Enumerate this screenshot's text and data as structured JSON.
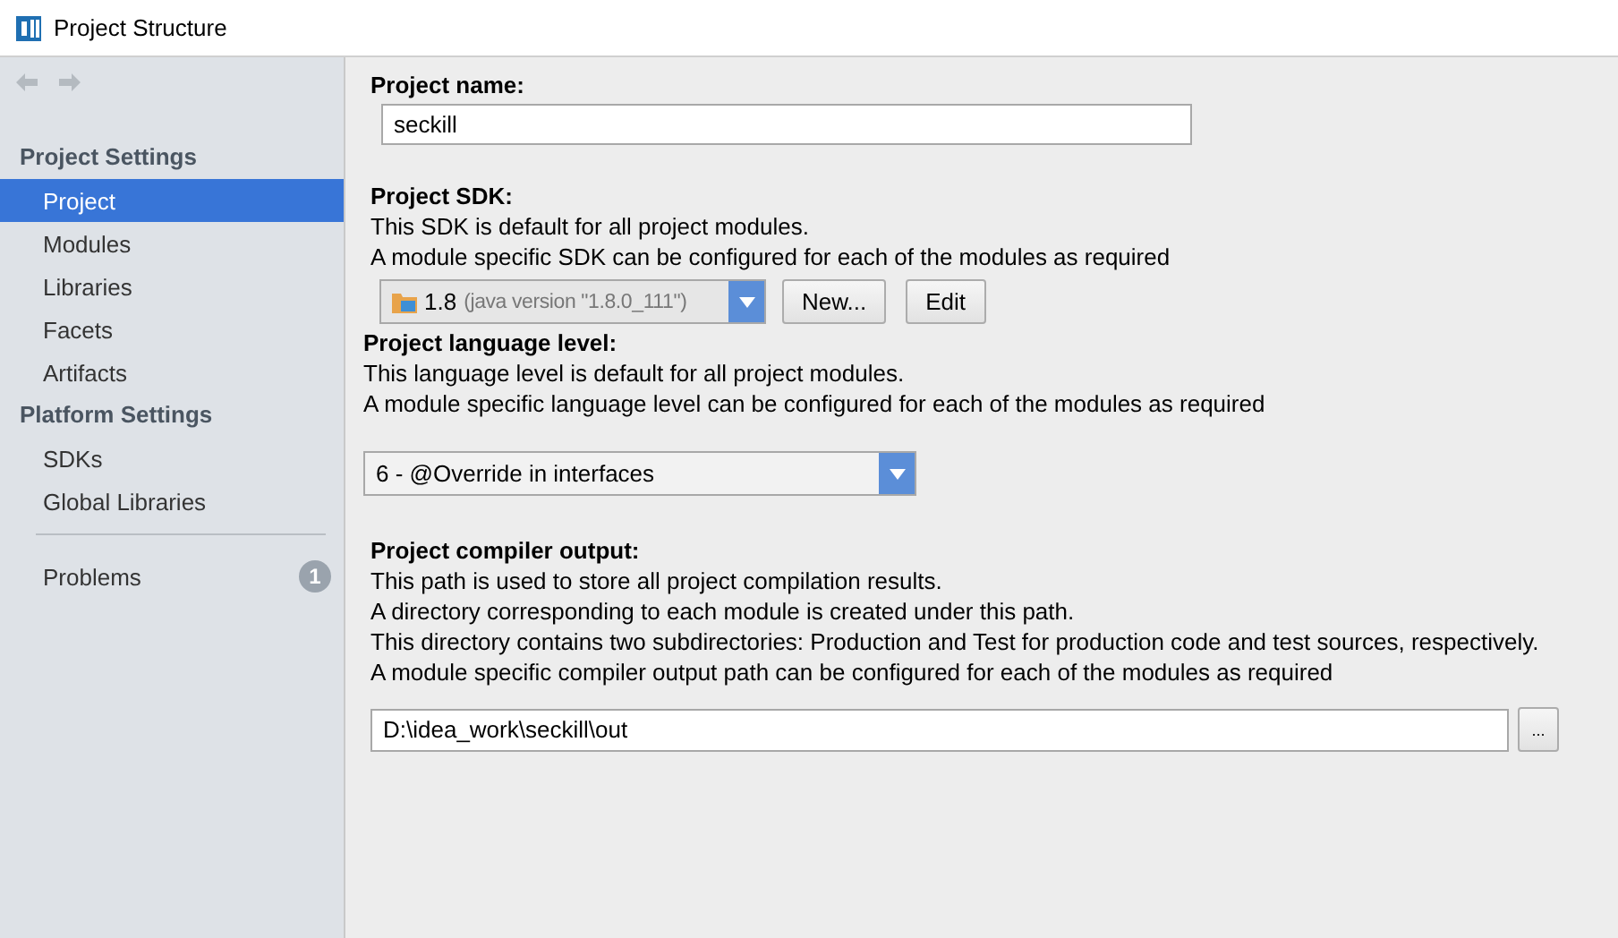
{
  "window": {
    "title": "Project Structure"
  },
  "sidebar": {
    "sections": [
      {
        "header": "Project Settings",
        "items": [
          {
            "label": "Project",
            "selected": true
          },
          {
            "label": "Modules",
            "selected": false
          },
          {
            "label": "Libraries",
            "selected": false
          },
          {
            "label": "Facets",
            "selected": false
          },
          {
            "label": "Artifacts",
            "selected": false
          }
        ]
      },
      {
        "header": "Platform Settings",
        "items": [
          {
            "label": "SDKs",
            "selected": false
          },
          {
            "label": "Global Libraries",
            "selected": false
          }
        ]
      }
    ],
    "problems": {
      "label": "Problems",
      "selected": false,
      "count": "1"
    }
  },
  "project_name": {
    "label": "Project name:",
    "value": "seckill"
  },
  "project_sdk": {
    "label": "Project SDK:",
    "description": [
      "This SDK is default for all project modules.",
      "A module specific SDK can be configured for each of the modules as required"
    ],
    "version": "1.8",
    "detail": "(java version \"1.8.0_111\")",
    "buttons": [
      "New...",
      "Edit"
    ]
  },
  "language_level": {
    "label": "Project language level:",
    "description": [
      "This language level is default for all project modules.",
      "A module specific language level can be configured for each of the modules as required"
    ],
    "value": "6 - @Override in interfaces"
  },
  "compiler_output": {
    "label": "Project compiler output:",
    "description": [
      "This path is used to store all project compilation results.",
      "A directory corresponding to each module is created under this path.",
      "This directory contains two subdirectories: Production and Test for production code and test sources, respectively.",
      "A module specific compiler output path can be configured for each of the modules as required"
    ],
    "value": "D:\\idea_work\\seckill\\out",
    "browse": "..."
  }
}
